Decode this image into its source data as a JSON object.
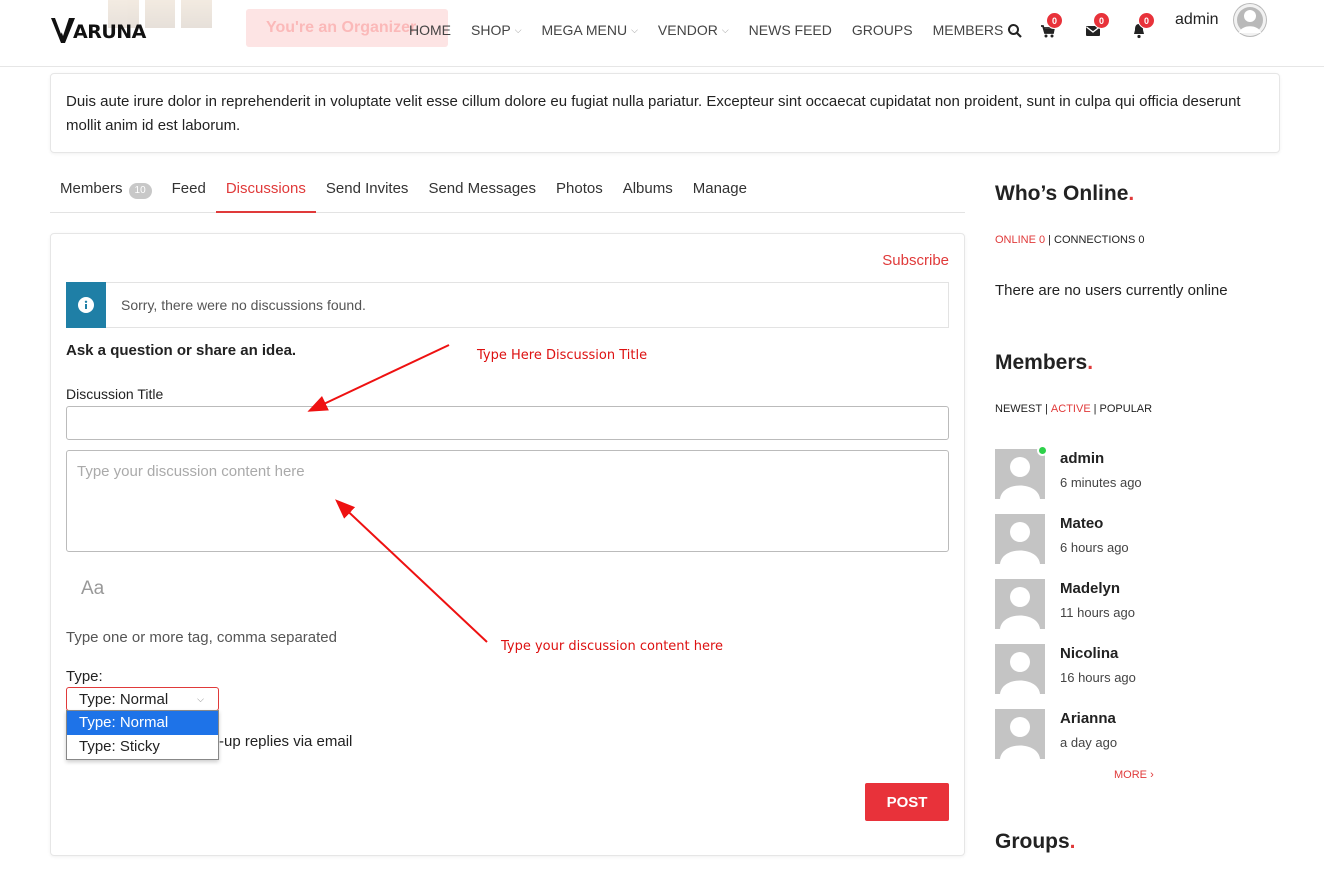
{
  "header": {
    "logo_text": "ARUNA",
    "faded_button": "You're an Organizer",
    "nav": [
      {
        "label": "HOME",
        "has_dropdown": false
      },
      {
        "label": "SHOP",
        "has_dropdown": true
      },
      {
        "label": "MEGA MENU",
        "has_dropdown": true
      },
      {
        "label": "VENDOR",
        "has_dropdown": true
      },
      {
        "label": "NEWS FEED",
        "has_dropdown": false
      },
      {
        "label": "GROUPS",
        "has_dropdown": false
      },
      {
        "label": "MEMBERS",
        "has_dropdown": true
      }
    ],
    "cart_count": "0",
    "messages_count": "0",
    "notifications_count": "0",
    "user_name": "admin"
  },
  "description": "Duis aute irure dolor in reprehenderit in voluptate velit esse cillum dolore eu fugiat nulla pariatur. Excepteur sint occaecat cupidatat non proident, sunt in culpa qui officia deserunt mollit anim id est laborum.",
  "tabs": [
    {
      "label": "Members",
      "count": "10"
    },
    {
      "label": "Feed"
    },
    {
      "label": "Discussions",
      "active": true
    },
    {
      "label": "Send Invites"
    },
    {
      "label": "Send Messages"
    },
    {
      "label": "Photos"
    },
    {
      "label": "Albums"
    },
    {
      "label": "Manage"
    }
  ],
  "panel": {
    "subscribe": "Subscribe",
    "notice": "Sorry, there were no discussions found.",
    "ask_heading": "Ask a question or share an idea.",
    "title_label": "Discussion Title",
    "title_value": "",
    "content_placeholder": "Type your discussion content here",
    "format_icon_text": "Aa",
    "tags_placeholder": "Type one or more tag, comma separated",
    "type_label": "Type:",
    "type_selected": "Type: Normal",
    "type_options": [
      "Type: Normal",
      "Type: Sticky"
    ],
    "notify_text_visible": "-up replies via email",
    "post_button": "POST"
  },
  "annotations": {
    "title_note": "Type Here Discussion Title",
    "content_note": "Type your discussion content here",
    "color": "#dd1111"
  },
  "sidebar": {
    "whos_online": {
      "title": "Who’s Online",
      "online_label": "ONLINE 0",
      "connections_label": "CONNECTIONS 0",
      "empty_text": "There are no users currently online"
    },
    "members": {
      "title": "Members",
      "filters": [
        "NEWEST",
        "ACTIVE",
        "POPULAR"
      ],
      "active_filter": "ACTIVE",
      "list": [
        {
          "name": "admin",
          "time": "6 minutes ago",
          "online": true
        },
        {
          "name": "Mateo",
          "time": "6 hours ago",
          "online": false
        },
        {
          "name": "Madelyn",
          "time": "11 hours ago",
          "online": false
        },
        {
          "name": "Nicolina",
          "time": "16 hours ago",
          "online": false
        },
        {
          "name": "Arianna",
          "time": "a day ago",
          "online": false
        }
      ],
      "more": "MORE"
    },
    "groups": {
      "title": "Groups"
    }
  },
  "colors": {
    "accent": "#e03a3a",
    "badge": "#e8323a",
    "notice_blue": "#1f7fa6",
    "online_green": "#2ed14a",
    "select_highlight": "#1e73e8"
  }
}
